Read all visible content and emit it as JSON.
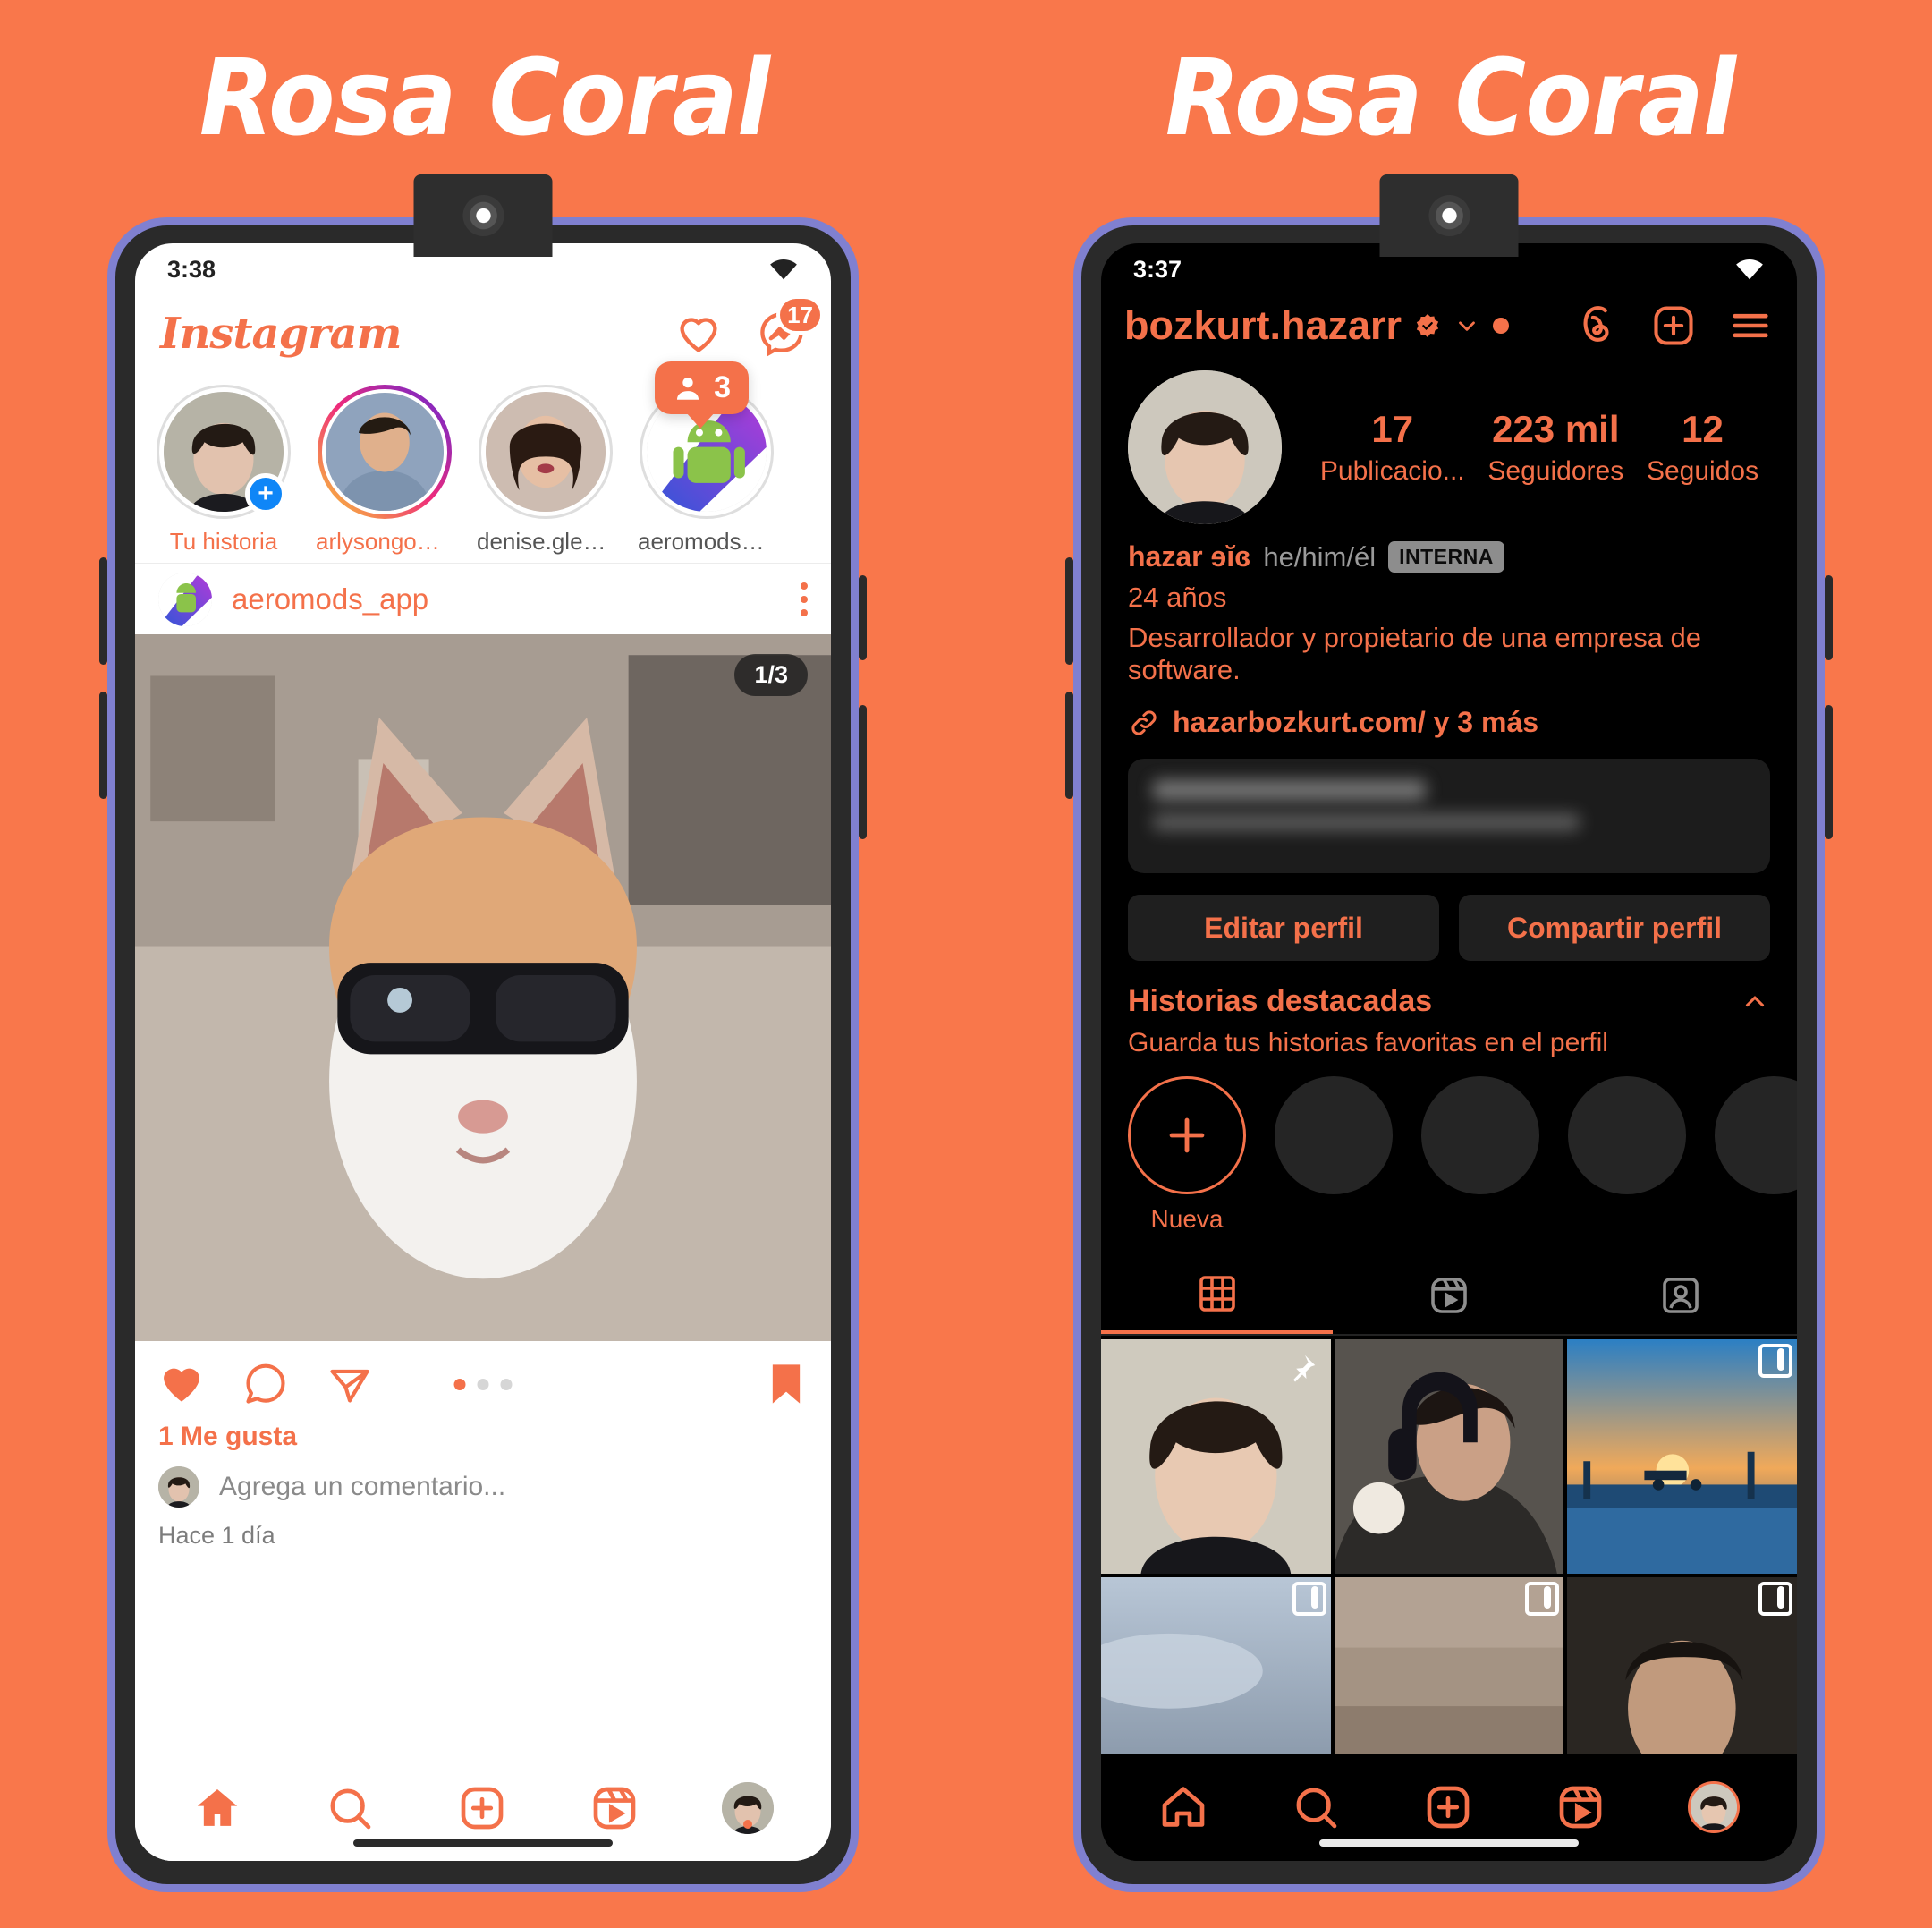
{
  "theme": {
    "background": "#f9774b",
    "accent": "#f4714a",
    "frame_purple": "#8080d0",
    "bezel_dark": "#2a2a2a",
    "dark_screen": "#000000",
    "light_screen": "#ffffff"
  },
  "banner": {
    "left_title": "Rosa Coral",
    "right_title": "Rosa Coral"
  },
  "left_phone": {
    "status": {
      "time": "3:38",
      "wifi_icon": "wifi-icon"
    },
    "header": {
      "logo": "Instagram",
      "heart_icon": "heart-outline-icon",
      "messenger_icon": "messenger-icon",
      "messenger_badge": "17",
      "tooltip": {
        "person_icon": "person-icon",
        "count": "3"
      }
    },
    "stories": [
      {
        "label": "Tu historia",
        "highlight": true,
        "ring": "plain",
        "has_plus": true
      },
      {
        "label": "arlysongomes...",
        "highlight": true,
        "ring": "gradient",
        "has_plus": false
      },
      {
        "label": "denise.glestm...",
        "highlight": false,
        "ring": "plain",
        "has_plus": false
      },
      {
        "label": "aeromods_app",
        "highlight": false,
        "ring": "plain",
        "has_plus": false
      }
    ],
    "post": {
      "username": "aeromods_app",
      "menu_icon": "more-options-icon",
      "carousel_indicator": "1/3",
      "actions": {
        "like_icon": "heart-filled-icon",
        "comment_icon": "comment-icon",
        "share_icon": "share-icon",
        "save_icon": "bookmark-filled-icon",
        "dots_total": 3,
        "dots_active": 1
      },
      "likes": "1 Me gusta",
      "comment_placeholder": "Agrega un comentario...",
      "timestamp": "Hace 1 día"
    },
    "bottom_nav": [
      {
        "icon": "home-icon",
        "name": "nav-home",
        "active": true
      },
      {
        "icon": "search-icon",
        "name": "nav-search",
        "active": false
      },
      {
        "icon": "create-icon",
        "name": "nav-create",
        "active": false
      },
      {
        "icon": "reels-icon",
        "name": "nav-reels",
        "active": false
      },
      {
        "icon": "profile-avatar",
        "name": "nav-profile",
        "active": false
      }
    ]
  },
  "right_phone": {
    "status": {
      "time": "3:37",
      "wifi_icon": "wifi-icon"
    },
    "header": {
      "username": "bozkurt.hazarr",
      "verified_icon": "verified-badge-icon",
      "chevron_icon": "chevron-down-icon",
      "live_dot_icon": "status-dot-icon",
      "threads_icon": "threads-icon",
      "add_icon": "plus-box-icon",
      "menu_icon": "hamburger-menu-icon"
    },
    "stats": [
      {
        "value": "17",
        "label": "Publicacio..."
      },
      {
        "value": "223 mil",
        "label": "Seguidores"
      },
      {
        "value": "12",
        "label": "Seguidos"
      }
    ],
    "bio": {
      "name": "hazar ɘĭɞ",
      "pronouns": "he/him/él",
      "chip": "INTERNA",
      "age": "24 años",
      "description": "Desarrollador y propietario de una empresa de software."
    },
    "link": {
      "icon": "link-icon",
      "text": "hazarbozkurt.com/ y 3 más"
    },
    "buttons": {
      "edit": "Editar perfil",
      "share": "Compartir perfil"
    },
    "highlights": {
      "title": "Historias destacadas",
      "subtitle": "Guarda tus historias favoritas en el perfil",
      "collapse_icon": "chevron-up-icon",
      "new_label": "Nueva",
      "empty_count": 4
    },
    "tabs": [
      {
        "icon": "grid-icon",
        "name": "tab-grid",
        "active": true
      },
      {
        "icon": "reels-icon",
        "name": "tab-reels",
        "active": false
      },
      {
        "icon": "tagged-icon",
        "name": "tab-tagged",
        "active": false
      }
    ],
    "grid": [
      {
        "pinned": true,
        "multi": false
      },
      {
        "pinned": false,
        "multi": false
      },
      {
        "pinned": false,
        "multi": true
      },
      {
        "pinned": false,
        "multi": true
      },
      {
        "pinned": false,
        "multi": true
      },
      {
        "pinned": false,
        "multi": true
      }
    ],
    "bottom_nav": [
      {
        "icon": "home-icon",
        "name": "nav-home",
        "active": false
      },
      {
        "icon": "search-icon",
        "name": "nav-search",
        "active": false
      },
      {
        "icon": "create-icon",
        "name": "nav-create",
        "active": false
      },
      {
        "icon": "reels-icon",
        "name": "nav-reels",
        "active": false
      },
      {
        "icon": "profile-avatar",
        "name": "nav-profile",
        "active": true
      }
    ]
  }
}
